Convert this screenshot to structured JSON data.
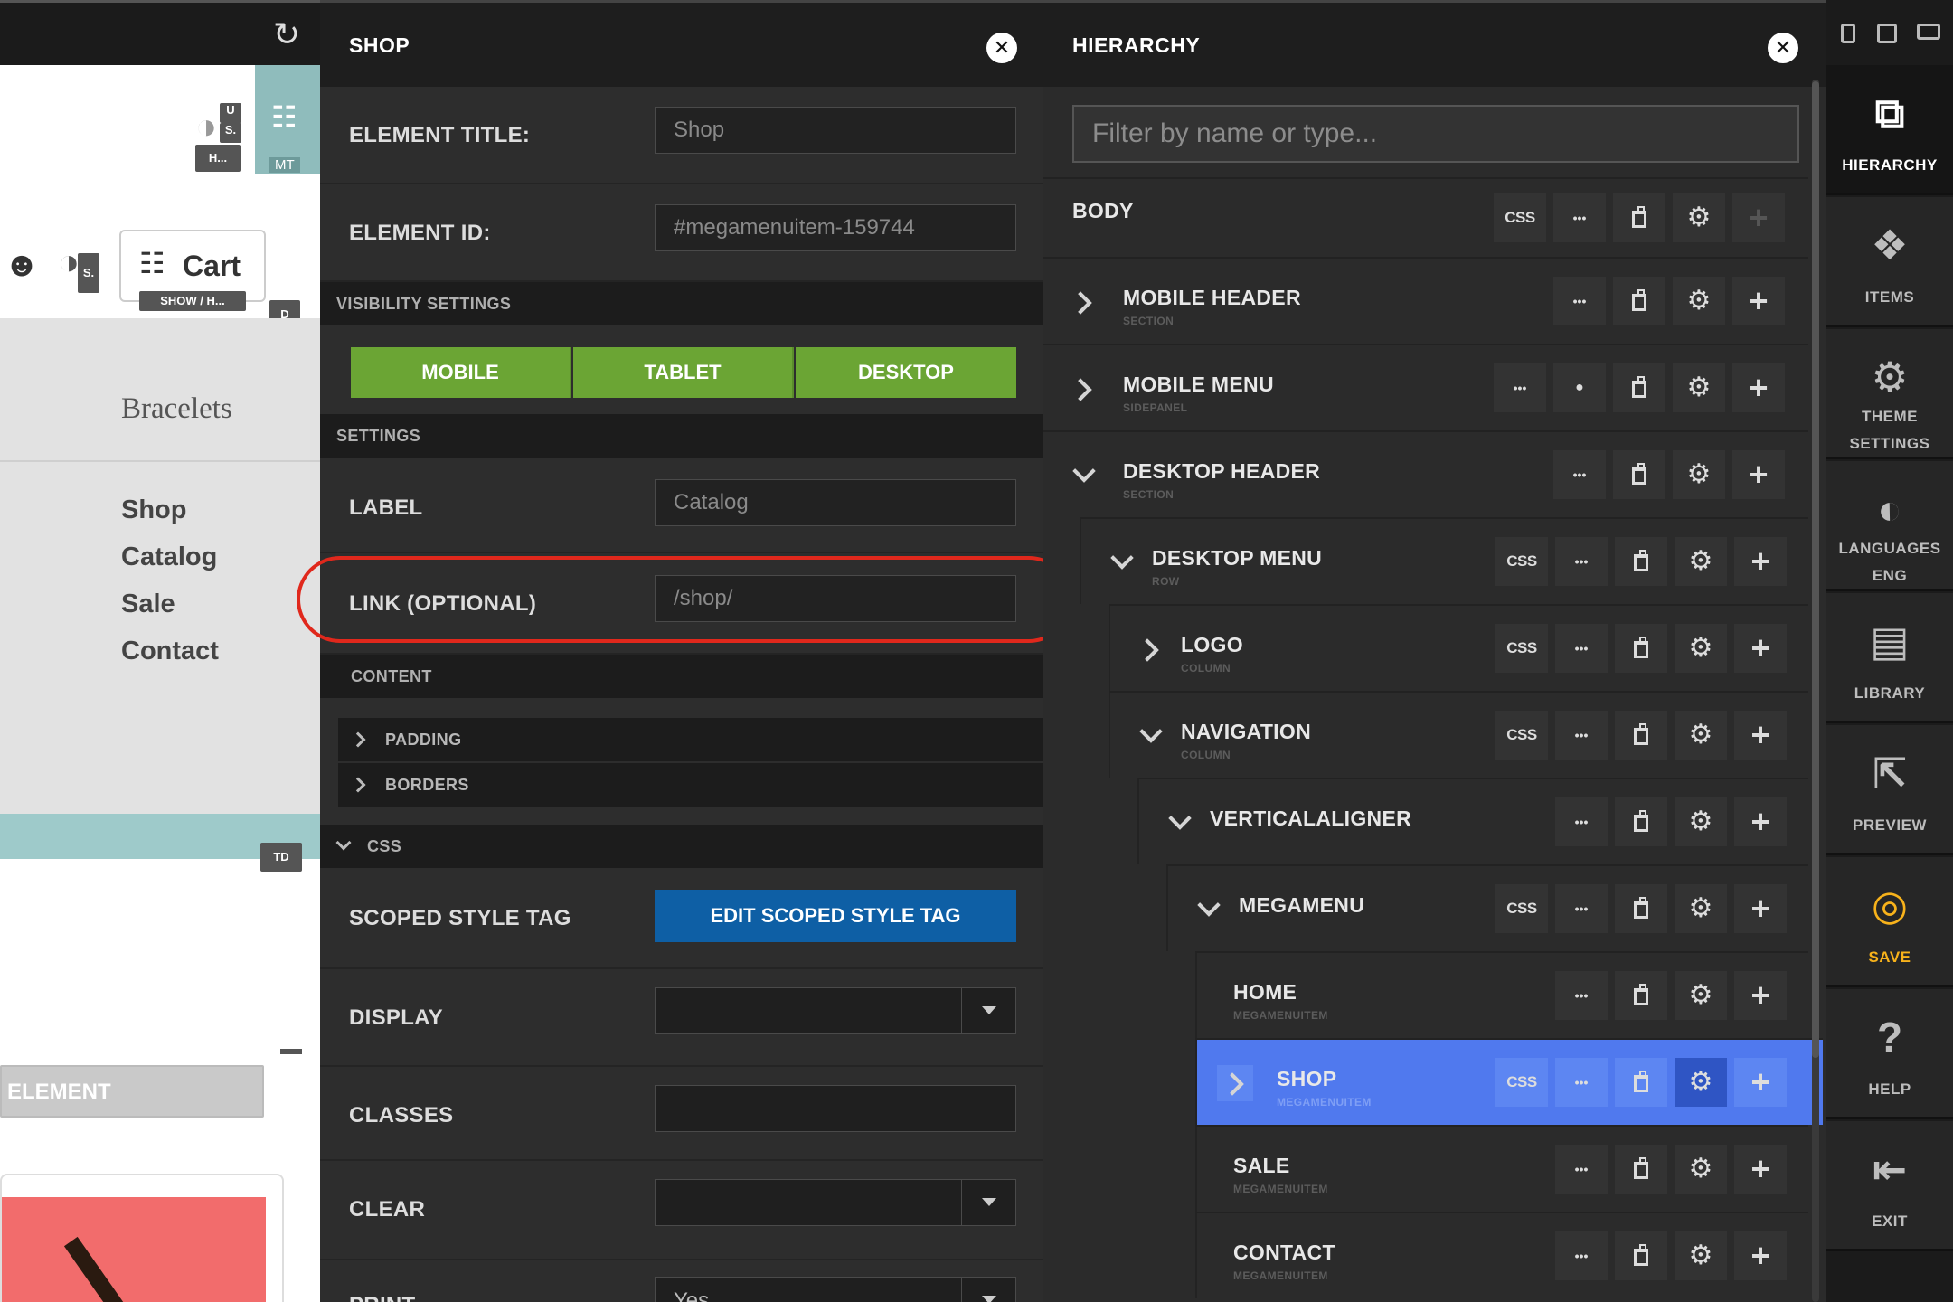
{
  "preview": {
    "cart_label": "Cart",
    "show_hide_tag": "SHOW / H...",
    "tag_d": "D",
    "tag_mt": "MT",
    "tag_td": "TD",
    "tag_u": "U",
    "tag_s": "S.",
    "tag_h": "H...",
    "tag_s2": "S.",
    "menu_heading": "Bracelets",
    "menu_items": [
      "Shop",
      "Catalog",
      "Sale",
      "Contact"
    ],
    "element_button": "ELEMENT"
  },
  "shop_panel": {
    "title": "SHOP",
    "element_title_label": "ELEMENT TITLE:",
    "element_title_value": "Shop",
    "element_id_label": "ELEMENT ID:",
    "element_id_value": "#megamenuitem-159744",
    "visibility_heading": "VISIBILITY SETTINGS",
    "visibility_buttons": [
      "MOBILE",
      "TABLET",
      "DESKTOP"
    ],
    "settings_heading": "SETTINGS",
    "label_label": "LABEL",
    "label_value": "Catalog",
    "link_label": "LINK (OPTIONAL)",
    "link_value": "/shop/",
    "content_heading": "CONTENT",
    "padding_label": "PADDING",
    "borders_label": "BORDERS",
    "css_heading": "CSS",
    "scoped_label": "SCOPED STYLE TAG",
    "scoped_button": "EDIT SCOPED STYLE TAG",
    "display_label": "DISPLAY",
    "classes_label": "CLASSES",
    "clear_label": "CLEAR",
    "print_label": "PRINT",
    "print_value": "Yes"
  },
  "hierarchy": {
    "title": "HIERARCHY",
    "filter_placeholder": "Filter by name or type...",
    "css_glyph": "CSS",
    "rows": [
      {
        "name": "BODY",
        "sub": ""
      },
      {
        "name": "MOBILE HEADER",
        "sub": "SECTION"
      },
      {
        "name": "MOBILE MENU",
        "sub": "SIDEPANEL"
      },
      {
        "name": "DESKTOP HEADER",
        "sub": "SECTION"
      },
      {
        "name": "DESKTOP MENU",
        "sub": "ROW"
      },
      {
        "name": "LOGO",
        "sub": "COLUMN"
      },
      {
        "name": "NAVIGATION",
        "sub": "COLUMN"
      },
      {
        "name": "VERTICALALIGNER",
        "sub": ""
      },
      {
        "name": "MEGAMENU",
        "sub": ""
      },
      {
        "name": "HOME",
        "sub": "MEGAMENUITEM"
      },
      {
        "name": "SHOP",
        "sub": "MEGAMENUITEM"
      },
      {
        "name": "SALE",
        "sub": "MEGAMENUITEM"
      },
      {
        "name": "CONTACT",
        "sub": "MEGAMENUITEM"
      }
    ]
  },
  "sidebar": {
    "items": [
      {
        "label": "HIERARCHY",
        "icon": "hierarchy-icon"
      },
      {
        "label": "ITEMS",
        "icon": "tags-icon"
      },
      {
        "label": "THEME\nSETTINGS",
        "icon": "gear-icon"
      },
      {
        "label": "LANGUAGES\nENG",
        "icon": "globe-icon"
      },
      {
        "label": "LIBRARY",
        "icon": "briefcase-icon"
      },
      {
        "label": "PREVIEW",
        "icon": "external-link-icon"
      },
      {
        "label": "SAVE",
        "icon": "database-icon"
      },
      {
        "label": "HELP",
        "icon": "question-icon"
      },
      {
        "label": "EXIT",
        "icon": "exit-icon"
      }
    ]
  },
  "colors": {
    "green": "#6ba534",
    "blue_button": "#0e5fa5",
    "selected_row": "#5079ee",
    "save": "#f7b21b",
    "highlight": "#e0281c"
  }
}
